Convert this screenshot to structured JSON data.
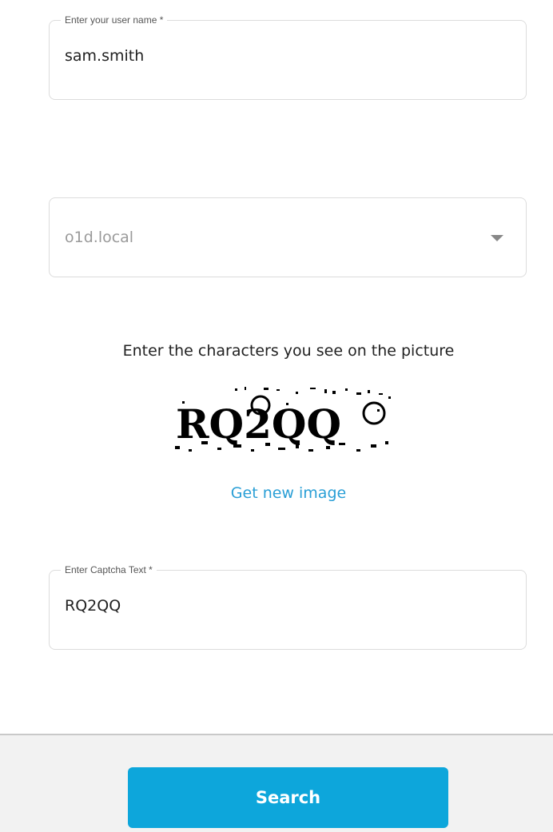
{
  "form": {
    "username": {
      "label": "Enter your user name *",
      "value": "sam.smith"
    },
    "domain": {
      "selected": "o1d.local"
    },
    "captcha": {
      "prompt": "Enter the characters you see on the picture",
      "image_text": "RQ2QQ",
      "new_image_link": "Get new image",
      "label": "Enter Captcha Text *",
      "value": "RQ2QQ"
    }
  },
  "footer": {
    "search_label": "Search"
  },
  "colors": {
    "accent": "#0da6db",
    "link": "#2a9fd6"
  }
}
